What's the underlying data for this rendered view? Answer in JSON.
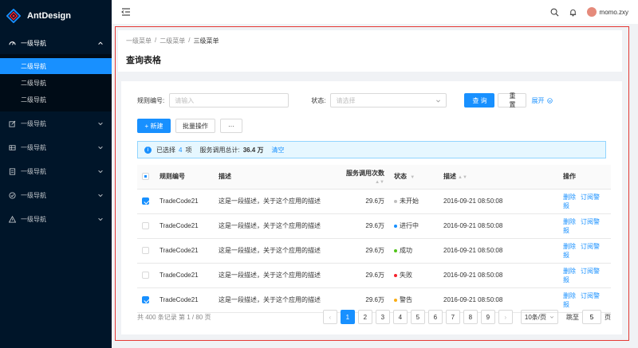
{
  "app": {
    "title": "AntDesign"
  },
  "sidebar": {
    "open_menu": {
      "label": "一级导航",
      "items": [
        {
          "label": "二级导航",
          "active": true
        },
        {
          "label": "二级导航",
          "active": false
        },
        {
          "label": "二级导航",
          "active": false
        }
      ]
    },
    "menus": [
      {
        "label": "一级导航",
        "icon": "edit-icon"
      },
      {
        "label": "一级导航",
        "icon": "table-icon"
      },
      {
        "label": "一级导航",
        "icon": "profile-icon"
      },
      {
        "label": "一级导航",
        "icon": "check-circle-icon"
      },
      {
        "label": "一级导航",
        "icon": "warning-icon"
      }
    ]
  },
  "header": {
    "username": "momo.zxy"
  },
  "breadcrumb": [
    "一级菜单",
    "二级菜单",
    "三级菜单"
  ],
  "page": {
    "title": "查询表格"
  },
  "form": {
    "rule_label": "规则编号:",
    "rule_placeholder": "请输入",
    "status_label": "状态:",
    "status_placeholder": "请选择",
    "query": "查 询",
    "reset": "重 置",
    "expand": "展开"
  },
  "toolbar": {
    "new": "+ 新建",
    "batch": "批量操作",
    "more": "···"
  },
  "alert": {
    "prefix": "已选择",
    "count": "4",
    "unit": "项",
    "total_label": "服务调用总计:",
    "total_value": "36.4 万",
    "clear": "清空"
  },
  "table": {
    "headers": {
      "rule": "规则编号",
      "desc": "描述",
      "calls": "服务调用次数",
      "status": "状态",
      "time": "描述",
      "ops": "操作"
    },
    "rows": [
      {
        "checked": true,
        "rule": "TradeCode21",
        "desc": "这是一段描述，关于这个应用的描述",
        "calls": "29.6万",
        "status": "未开始",
        "status_color": "#bfbfbf",
        "time": "2016-09-21  08:50:08",
        "op1": "删除",
        "op2": "订阅警报"
      },
      {
        "checked": false,
        "rule": "TradeCode21",
        "desc": "这是一段描述，关于这个应用的描述",
        "calls": "29.6万",
        "status": "进行中",
        "status_color": "#1890ff",
        "time": "2016-09-21  08:50:08",
        "op1": "删除",
        "op2": "订阅警报"
      },
      {
        "checked": false,
        "rule": "TradeCode21",
        "desc": "这是一段描述，关于这个应用的描述",
        "calls": "29.6万",
        "status": "成功",
        "status_color": "#52c41a",
        "time": "2016-09-21  08:50:08",
        "op1": "删除",
        "op2": "订阅警报"
      },
      {
        "checked": false,
        "rule": "TradeCode21",
        "desc": "这是一段描述，关于这个应用的描述",
        "calls": "29.6万",
        "status": "失败",
        "status_color": "#f5222d",
        "time": "2016-09-21  08:50:08",
        "op1": "删除",
        "op2": "订阅警报"
      },
      {
        "checked": true,
        "rule": "TradeCode21",
        "desc": "这是一段描述，关于这个应用的描述",
        "calls": "29.6万",
        "status": "警告",
        "status_color": "#faad14",
        "time": "2016-09-21  08:50:08",
        "op1": "删除",
        "op2": "订阅警报"
      }
    ]
  },
  "pagination": {
    "summary": "共 400 条记录 第 1 / 80 页",
    "pages": [
      "1",
      "2",
      "3",
      "4",
      "5",
      "6",
      "7",
      "8",
      "9"
    ],
    "current": "1",
    "page_size": "10条/页",
    "jump_label": "跳至",
    "jump_value": "5",
    "page_unit": "页"
  },
  "colors": {
    "primary": "#1890ff",
    "sider": "#001529",
    "annotation": "#e53935"
  }
}
